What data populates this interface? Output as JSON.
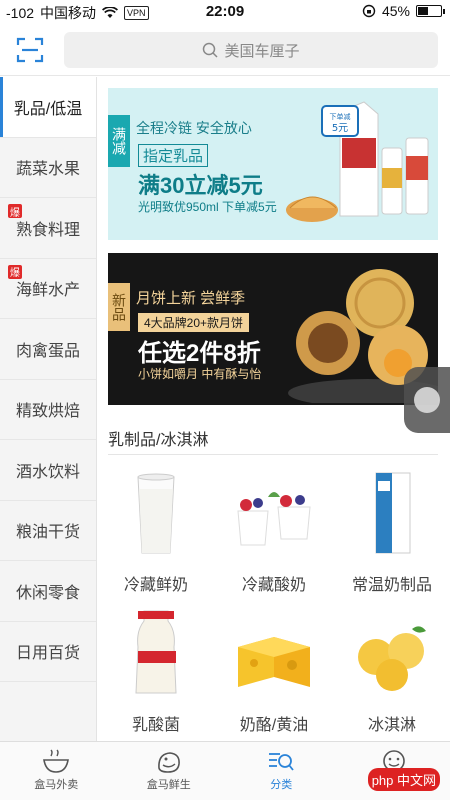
{
  "status_bar": {
    "signal": "-102",
    "carrier": "中国移动",
    "vpn": "VPN",
    "time": "22:09",
    "battery": "45%",
    "battery_level": 0.45
  },
  "header": {
    "search_placeholder": "美国车厘子"
  },
  "sidebar": {
    "items": [
      {
        "label": "乳品/低温",
        "active": true,
        "badge": ""
      },
      {
        "label": "蔬菜水果",
        "active": false,
        "badge": ""
      },
      {
        "label": "熟食料理",
        "active": false,
        "badge": "爆"
      },
      {
        "label": "海鲜水产",
        "active": false,
        "badge": "爆"
      },
      {
        "label": "肉禽蛋品",
        "active": false,
        "badge": ""
      },
      {
        "label": "精致烘焙",
        "active": false,
        "badge": ""
      },
      {
        "label": "酒水饮料",
        "active": false,
        "badge": ""
      },
      {
        "label": "粮油干货",
        "active": false,
        "badge": ""
      },
      {
        "label": "休闲零食",
        "active": false,
        "badge": ""
      },
      {
        "label": "日用百货",
        "active": false,
        "badge": ""
      }
    ]
  },
  "banners": {
    "banner1": {
      "tag": "满减",
      "line1": "全程冷链 安全放心",
      "line2": "指定乳品",
      "line3": "满30立减5元",
      "line4": "光明致优950ml 下单减5元",
      "sticker": "下单减5元"
    },
    "banner2": {
      "tag": "新品",
      "line1": "月饼上新 尝鲜季",
      "line2": "4大品牌20+款月饼",
      "line3": "任选2件8折",
      "line4": "小饼如嚼月 中有酥与怡"
    }
  },
  "section": {
    "title": "乳制品/冰淇淋",
    "items": [
      {
        "label": "冷藏鲜奶"
      },
      {
        "label": "冷藏酸奶"
      },
      {
        "label": "常温奶制品"
      },
      {
        "label": "乳酸菌"
      },
      {
        "label": "奶酪/黄油"
      },
      {
        "label": "冰淇淋"
      }
    ]
  },
  "bottom_nav": {
    "items": [
      {
        "label": "盒马外卖",
        "active": false
      },
      {
        "label": "盒马鲜生",
        "active": false
      },
      {
        "label": "分类",
        "active": true
      },
      {
        "label": "我的",
        "active": false
      }
    ]
  },
  "watermark": "php 中文网",
  "colors": {
    "accent": "#2a83d8",
    "hot_badge": "#e02a2a"
  }
}
